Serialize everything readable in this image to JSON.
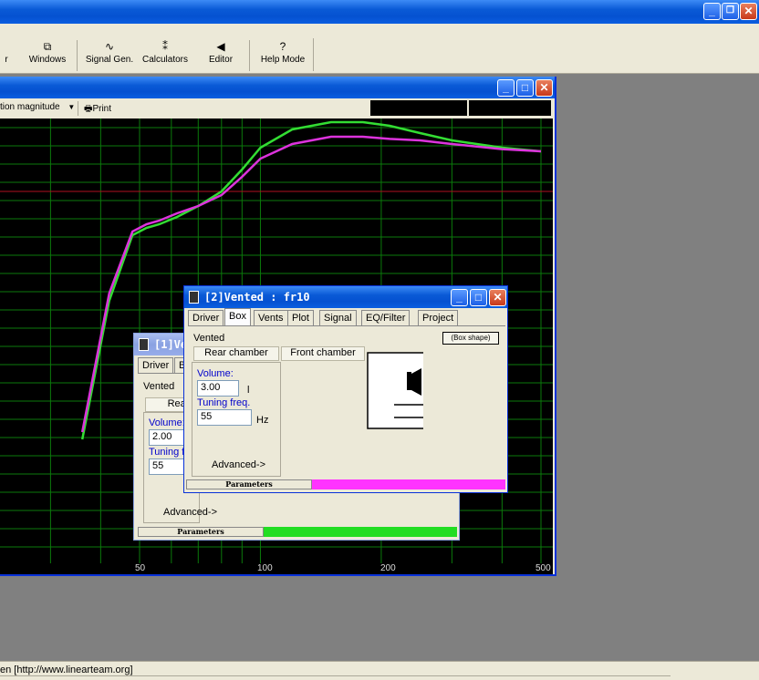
{
  "toolbar": {
    "items": [
      {
        "label": "r",
        "icon": "partial-icon"
      },
      {
        "label": "Windows",
        "icon": "windows-icon"
      },
      {
        "label": "Signal Gen.",
        "icon": "signal-gen-icon"
      },
      {
        "label": "Calculators",
        "icon": "calculator-icon"
      },
      {
        "label": "Editor",
        "icon": "editor-icon"
      },
      {
        "label": "Help Mode",
        "icon": "help-icon"
      }
    ]
  },
  "plot_window": {
    "dropdown_value": "tion magnitude",
    "print_label": "Print"
  },
  "chart_data": {
    "type": "line",
    "x_scale": "log",
    "xlim": [
      20,
      500
    ],
    "x_tick_labels": [
      "50",
      "100",
      "200",
      "500"
    ],
    "grid": true,
    "series": [
      {
        "color": "#33dd33",
        "x": [
          36,
          42,
          48,
          52,
          56,
          62,
          70,
          80,
          90,
          100,
          120,
          150,
          180,
          210,
          250,
          300,
          400,
          500
        ],
        "y": [
          -3.4,
          -1.5,
          -0.6,
          -0.5,
          -0.45,
          -0.35,
          -0.2,
          0.0,
          0.3,
          0.6,
          0.85,
          0.95,
          0.95,
          0.9,
          0.8,
          0.7,
          0.6,
          0.55
        ]
      },
      {
        "color": "#dd33dd",
        "x": [
          36,
          42,
          48,
          52,
          56,
          62,
          70,
          80,
          90,
          100,
          120,
          150,
          180,
          210,
          250,
          300,
          400,
          500
        ],
        "y": [
          -3.3,
          -1.4,
          -0.55,
          -0.45,
          -0.4,
          -0.3,
          -0.2,
          -0.05,
          0.2,
          0.45,
          0.65,
          0.75,
          0.75,
          0.72,
          0.7,
          0.65,
          0.58,
          0.55
        ]
      }
    ]
  },
  "vented2": {
    "title": "[2]Vented : fr10",
    "tabs": [
      "Driver",
      "Box",
      "Vents",
      "Plot",
      "Signal",
      "EQ/Filter",
      "Project"
    ],
    "type_label": "Vented",
    "box_shape_label": "(Box shape)",
    "rear_chamber_label": "Rear chamber",
    "front_chamber_label": "Front chamber",
    "volume_label": "Volume:",
    "volume_value": "3.00",
    "volume_unit": "l",
    "tuning_label": "Tuning freq.",
    "tuning_value": "55",
    "tuning_unit": "Hz",
    "advanced_label": "Advanced->",
    "parameters_label": "Parameters",
    "status_color": "#ff33ff"
  },
  "vented1": {
    "title": "[1]Ve",
    "tab_driver": "Driver",
    "tab_b": "B",
    "type_label": "Vented",
    "rear_label": "Rear c",
    "volume_label": "Volume:",
    "volume_value": "2.00",
    "tuning_label": "Tuning fr",
    "tuning_value": "55",
    "advanced_label": "Advanced->",
    "parameters_label": "Parameters",
    "status_color": "#22dd22"
  },
  "statusbar": {
    "text": "en [http://www.linearteam.org]"
  }
}
